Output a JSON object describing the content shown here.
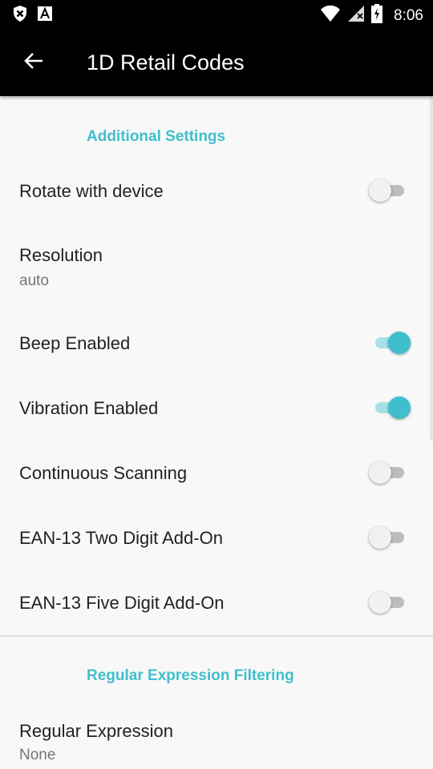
{
  "status_bar": {
    "time": "8:06",
    "icons": [
      "close-shield-icon",
      "a-letter-icon",
      "wifi-icon",
      "signal-icon",
      "battery-charging-icon"
    ]
  },
  "app_bar": {
    "back_icon": "arrow-back-icon",
    "title": "1D Retail Codes"
  },
  "sections": {
    "additional": {
      "header": "Additional Settings",
      "rotate": {
        "title": "Rotate with device",
        "checked": false
      },
      "resolution": {
        "title": "Resolution",
        "summary": "auto"
      },
      "beep": {
        "title": "Beep Enabled",
        "checked": true
      },
      "vibration": {
        "title": "Vibration Enabled",
        "checked": true
      },
      "continuous": {
        "title": "Continuous Scanning",
        "checked": false
      },
      "ean13_two": {
        "title": "EAN-13 Two Digit Add-On",
        "checked": false
      },
      "ean13_five": {
        "title": "EAN-13 Five Digit Add-On",
        "checked": false
      }
    },
    "regex": {
      "header": "Regular Expression Filtering",
      "expression": {
        "title": "Regular Expression",
        "summary": "None"
      }
    }
  },
  "colors": {
    "accent": "#3fbfcd",
    "accent_track": "#a7e1e7",
    "bar_background": "#000000",
    "page_background": "#f8f8f8"
  }
}
